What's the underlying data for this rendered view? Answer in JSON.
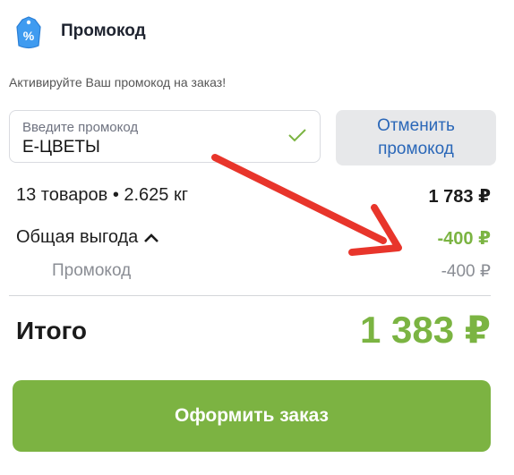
{
  "header": {
    "title": "Промокод",
    "hint": "Активируйте Ваш промокод на заказ!"
  },
  "promo_field": {
    "placeholder": "Введите промокод",
    "value": "Е-ЦВЕТЫ"
  },
  "cancel_button": {
    "line1": "Отменить",
    "line2": "промокод"
  },
  "summary": {
    "items_label": "13 товаров • 2.625 кг",
    "items_price": "1 783 ₽",
    "benefit_label": "Общая выгода",
    "benefit_value": "-400 ₽",
    "promo_label": "Промокод",
    "promo_value": "-400 ₽"
  },
  "total": {
    "label": "Итого",
    "value": "1 383 ₽"
  },
  "checkout_button": {
    "label": "Оформить заказ"
  },
  "colors": {
    "accent_green": "#7cb342",
    "link_blue": "#2a67b8",
    "arrow_red": "#e8352b"
  }
}
